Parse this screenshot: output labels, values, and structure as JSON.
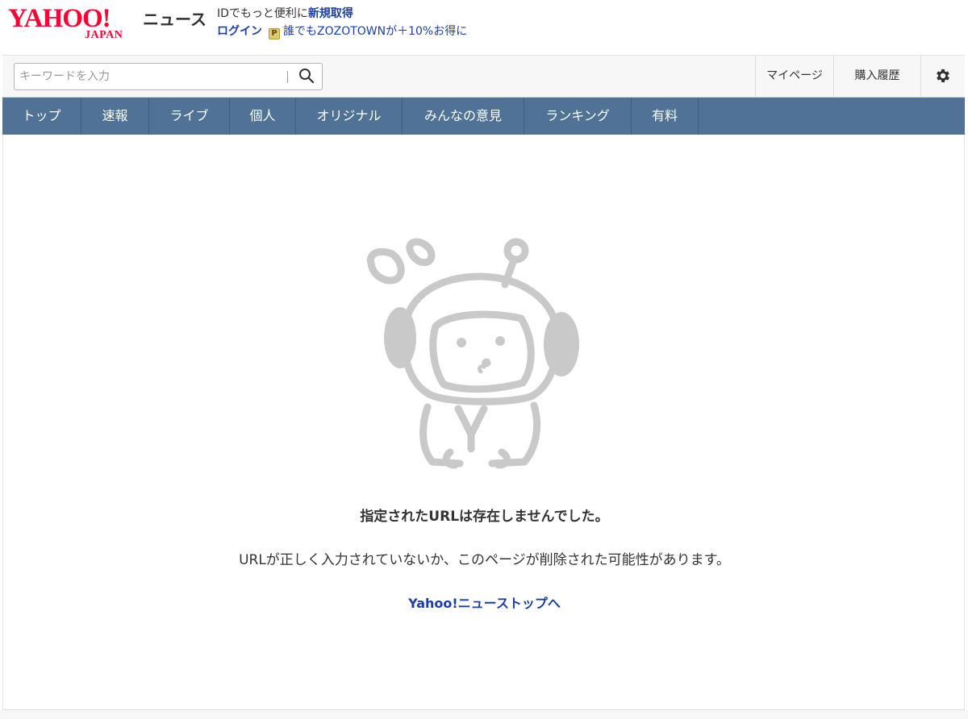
{
  "header": {
    "logo_text": "YAHOO!",
    "logo_sub": "JAPAN",
    "service_name": "ニュース",
    "promo_text": "IDでもっと便利に",
    "promo_signup": "新規取得",
    "login_label": "ログイン",
    "paypay_badge": "P",
    "zozo_promo": "誰でもZOZOTOWNが＋10%お得に"
  },
  "search": {
    "placeholder": "キーワードを入力",
    "icon": "search-icon"
  },
  "utility": {
    "mypage": "マイページ",
    "history": "購入履歴",
    "settings_icon": "gear-icon"
  },
  "nav": {
    "items": [
      {
        "label": "トップ"
      },
      {
        "label": "速報"
      },
      {
        "label": "ライブ"
      },
      {
        "label": "個人"
      },
      {
        "label": "オリジナル"
      },
      {
        "label": "みんなの意見"
      },
      {
        "label": "ランキング"
      },
      {
        "label": "有料"
      }
    ]
  },
  "error": {
    "mascot_icon": "sad-mascot-illustration",
    "title": "指定されたURLは存在しませんでした。",
    "description": "URLが正しく入力されていないか、このページが削除された可能性があります。",
    "link_label": "Yahoo!ニューストップへ"
  },
  "colors": {
    "brand": "#ff0033",
    "nav_bg": "#4f7296",
    "link": "#1a3fa8",
    "mascot": "#c9c9c9"
  }
}
